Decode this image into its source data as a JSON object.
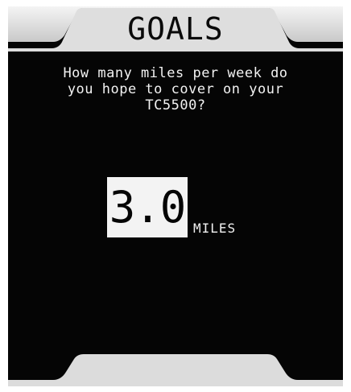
{
  "header": {
    "title": "GOALS"
  },
  "prompt": {
    "line1": "How many miles per week do",
    "line2": "you hope to cover on your",
    "line3": "TC5500?"
  },
  "goal": {
    "value": "3.0",
    "unit": "MILES"
  },
  "colors": {
    "screen_background": "#050505",
    "frame_silver": "#dcdcdc",
    "text_light": "#f2f2f2",
    "value_box": "#f3f3f3"
  }
}
